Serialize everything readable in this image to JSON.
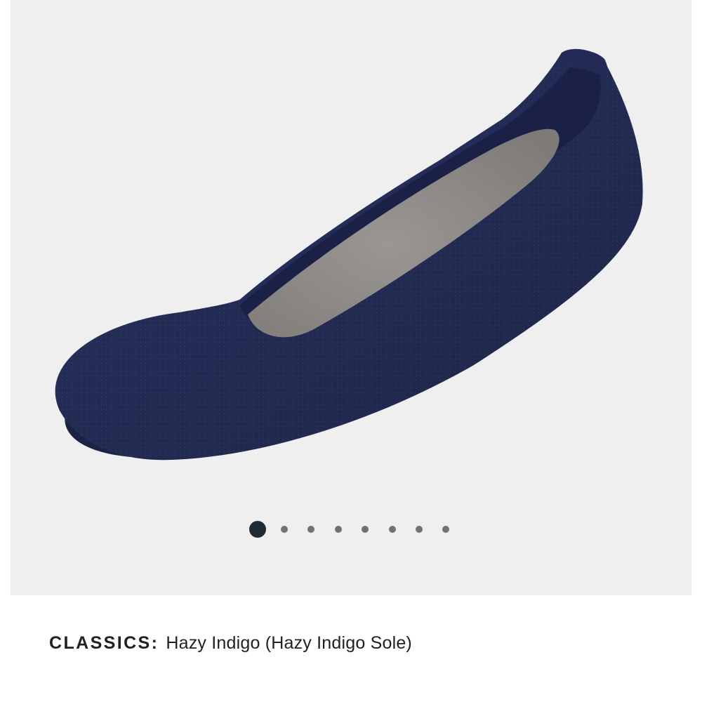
{
  "gallery": {
    "image_alt": "Hazy Indigo ballet flat",
    "slide_count": 8,
    "active_slide": 1,
    "colors": {
      "background": "#efeff0",
      "shoe_knit": "#2a3566",
      "insole": "#8e8a87",
      "dot_active": "#1f2a33",
      "dot_inactive": "#6b7278"
    }
  },
  "product": {
    "collection_label": "CLASSICS:",
    "color_name": "Hazy Indigo (Hazy Indigo Sole)"
  }
}
